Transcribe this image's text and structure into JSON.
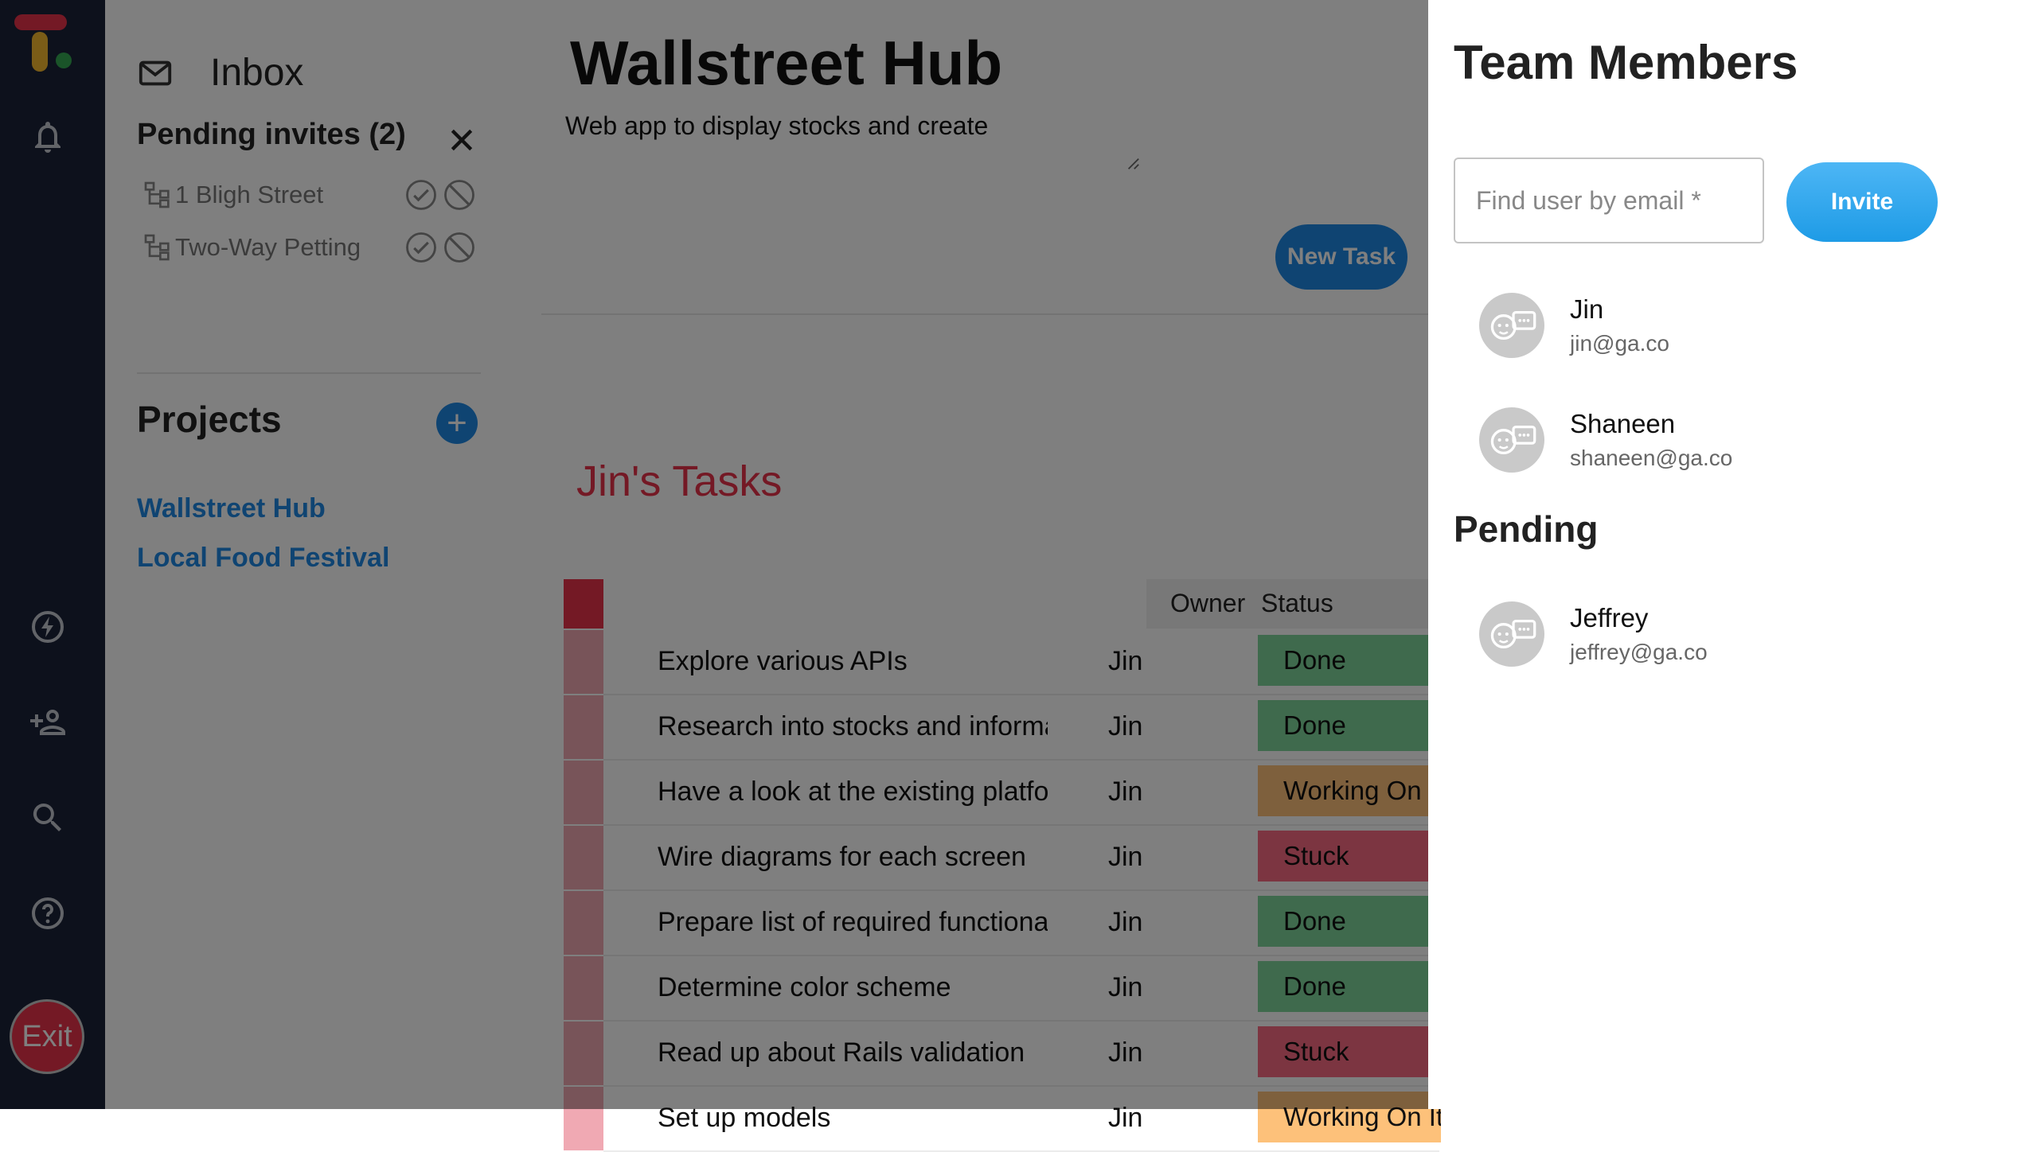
{
  "colors": {
    "rail_bg": "#1b2238",
    "accent_blue": "#1e88e5",
    "logo_red": "#e8334a",
    "logo_yellow": "#f5b82e",
    "logo_green": "#34a853",
    "status_done": "#7ed59b",
    "status_working": "#fdc17a",
    "status_stuck": "#f86b82",
    "exit_red": "#e8334a"
  },
  "rail": {
    "icons": [
      "bell-icon",
      "bolt-icon",
      "add-person-icon",
      "search-icon",
      "help-icon"
    ],
    "exit_label": "Exit"
  },
  "inbox": {
    "title": "Inbox",
    "pending_title": "Pending invites (2)",
    "invites": [
      {
        "name": "1 Bligh Street"
      },
      {
        "name": "Two-Way Petting"
      }
    ]
  },
  "projects": {
    "title": "Projects",
    "add_label": "+",
    "items": [
      "Wallstreet Hub",
      "Local Food Festival"
    ]
  },
  "project": {
    "title": "Wallstreet Hub",
    "description": "Web app to display stocks and create",
    "new_task_label": "New Task"
  },
  "tasks": {
    "title": "Jin's Tasks",
    "columns": {
      "owner": "Owner",
      "status": "Status"
    },
    "rows": [
      {
        "task": "Explore various APIs",
        "owner": "Jin",
        "status": "Done"
      },
      {
        "task": "Research into stocks and information",
        "owner": "Jin",
        "status": "Done"
      },
      {
        "task": "Have a look at the existing platforms",
        "owner": "Jin",
        "status": "Working On It"
      },
      {
        "task": "Wire diagrams for each screen",
        "owner": "Jin",
        "status": "Stuck"
      },
      {
        "task": "Prepare list of required functionality",
        "owner": "Jin",
        "status": "Done"
      },
      {
        "task": "Determine color scheme",
        "owner": "Jin",
        "status": "Done"
      },
      {
        "task": "Read up about Rails validation",
        "owner": "Jin",
        "status": "Stuck"
      },
      {
        "task": "Set up models",
        "owner": "Jin",
        "status": "Working On It"
      }
    ]
  },
  "team": {
    "title": "Team Members",
    "search_placeholder": "Find user by email *",
    "invite_label": "Invite",
    "members": [
      {
        "name": "Jin",
        "email": "jin@ga.co"
      },
      {
        "name": "Shaneen",
        "email": "shaneen@ga.co"
      }
    ],
    "pending_title": "Pending",
    "pending": [
      {
        "name": "Jeffrey",
        "email": "jeffrey@ga.co"
      }
    ]
  }
}
